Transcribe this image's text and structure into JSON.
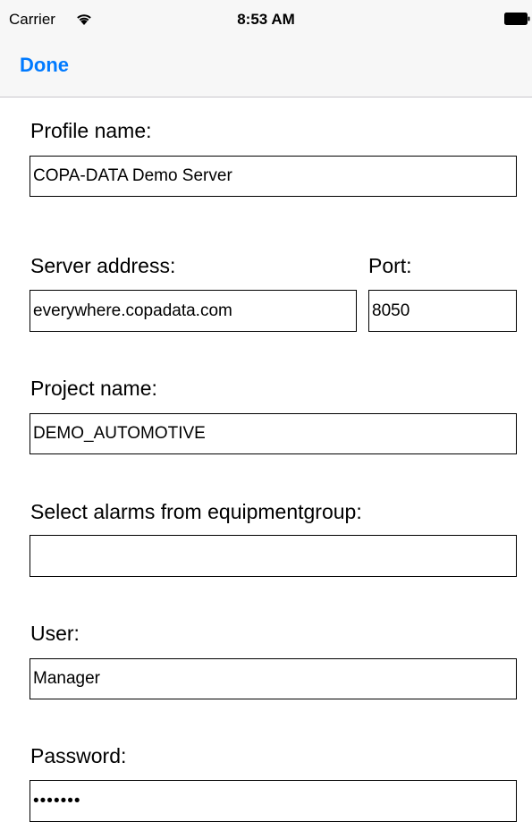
{
  "status_bar": {
    "carrier": "Carrier",
    "time": "8:53 AM",
    "wifi_icon": "wifi-icon",
    "battery_icon": "battery-full-icon"
  },
  "nav": {
    "done_label": "Done",
    "accent_color": "#007aff"
  },
  "form": {
    "profile_name": {
      "label": "Profile name:",
      "value": "COPA-DATA Demo Server"
    },
    "server_address": {
      "label": "Server address:",
      "value": "everywhere.copadata.com"
    },
    "port": {
      "label": "Port:",
      "value": "8050"
    },
    "project_name": {
      "label": "Project name:",
      "value": "DEMO_AUTOMOTIVE"
    },
    "equipment_group": {
      "label": "Select alarms from equipmentgroup:",
      "value": ""
    },
    "user": {
      "label": "User:",
      "value": "Manager"
    },
    "password": {
      "label": "Password:",
      "value": "•••••••"
    }
  }
}
